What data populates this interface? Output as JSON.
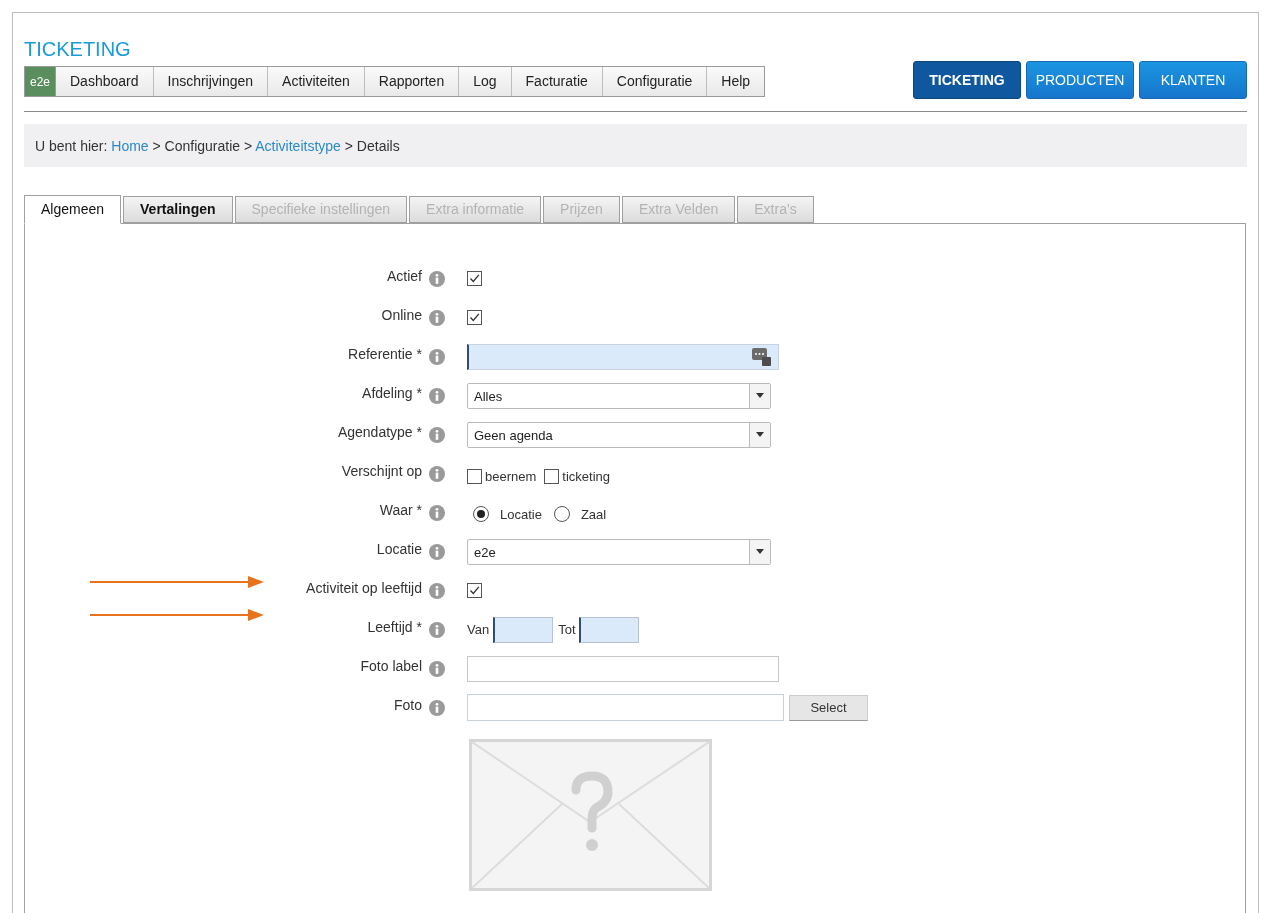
{
  "app_title": "TICKETING",
  "logo": "e2e",
  "menu": [
    {
      "label": "Dashboard"
    },
    {
      "label": "Inschrijvingen"
    },
    {
      "label": "Activiteiten"
    },
    {
      "label": "Rapporten"
    },
    {
      "label": "Log"
    },
    {
      "label": "Facturatie"
    },
    {
      "label": "Configuratie"
    },
    {
      "label": "Help"
    }
  ],
  "modules": [
    {
      "label": "TICKETING",
      "selected": true
    },
    {
      "label": "PRODUCTEN",
      "selected": false
    },
    {
      "label": "KLANTEN",
      "selected": false
    }
  ],
  "breadcrumb": {
    "prefix": "U bent hier:",
    "separator": ">",
    "items": [
      {
        "label": "Home",
        "link": true
      },
      {
        "label": "Configuratie",
        "link": false
      },
      {
        "label": "Activiteitstype",
        "link": true
      },
      {
        "label": "Details",
        "link": false
      }
    ]
  },
  "tabs": [
    {
      "label": "Algemeen",
      "selected": true,
      "disabled": false
    },
    {
      "label": "Vertalingen",
      "selected": false,
      "disabled": false
    },
    {
      "label": "Specifieke instellingen",
      "selected": false,
      "disabled": true
    },
    {
      "label": "Extra informatie",
      "selected": false,
      "disabled": true
    },
    {
      "label": "Prijzen",
      "selected": false,
      "disabled": true
    },
    {
      "label": "Extra Velden",
      "selected": false,
      "disabled": true
    },
    {
      "label": "Extra's",
      "selected": false,
      "disabled": true
    }
  ],
  "fields": [
    {
      "kind": "checkbox",
      "label": "Actief",
      "checked": true
    },
    {
      "kind": "checkbox",
      "label": "Online",
      "checked": true
    },
    {
      "kind": "text",
      "label": "Referentie *",
      "focused": true,
      "counter": true
    },
    {
      "kind": "select",
      "label": "Afdeling *",
      "value": "Alles"
    },
    {
      "kind": "select",
      "label": "Agendatype *",
      "value": "Geen agenda"
    },
    {
      "kind": "checkbox-group",
      "label": "Verschijnt op",
      "options": [
        {
          "label": "beernem",
          "checked": false
        },
        {
          "label": "ticketing",
          "checked": false
        }
      ]
    },
    {
      "kind": "radio-group",
      "label": "Waar *",
      "options": [
        {
          "label": "Locatie",
          "selected": true
        },
        {
          "label": "Zaal",
          "selected": false
        }
      ]
    },
    {
      "kind": "select",
      "label": "Locatie",
      "value": "e2e"
    },
    {
      "kind": "checkbox",
      "label": "Activiteit op leeftijd",
      "checked": true
    },
    {
      "kind": "range",
      "label": "Leeftijd *",
      "from_label": "Van",
      "to_label": "Tot"
    },
    {
      "kind": "text",
      "label": "Foto label",
      "focused": false,
      "counter": false
    },
    {
      "kind": "file",
      "label": "Foto",
      "button": "Select"
    }
  ],
  "annotation_arrows": [
    {
      "kind": "arrow"
    },
    {
      "kind": "arrow"
    }
  ]
}
